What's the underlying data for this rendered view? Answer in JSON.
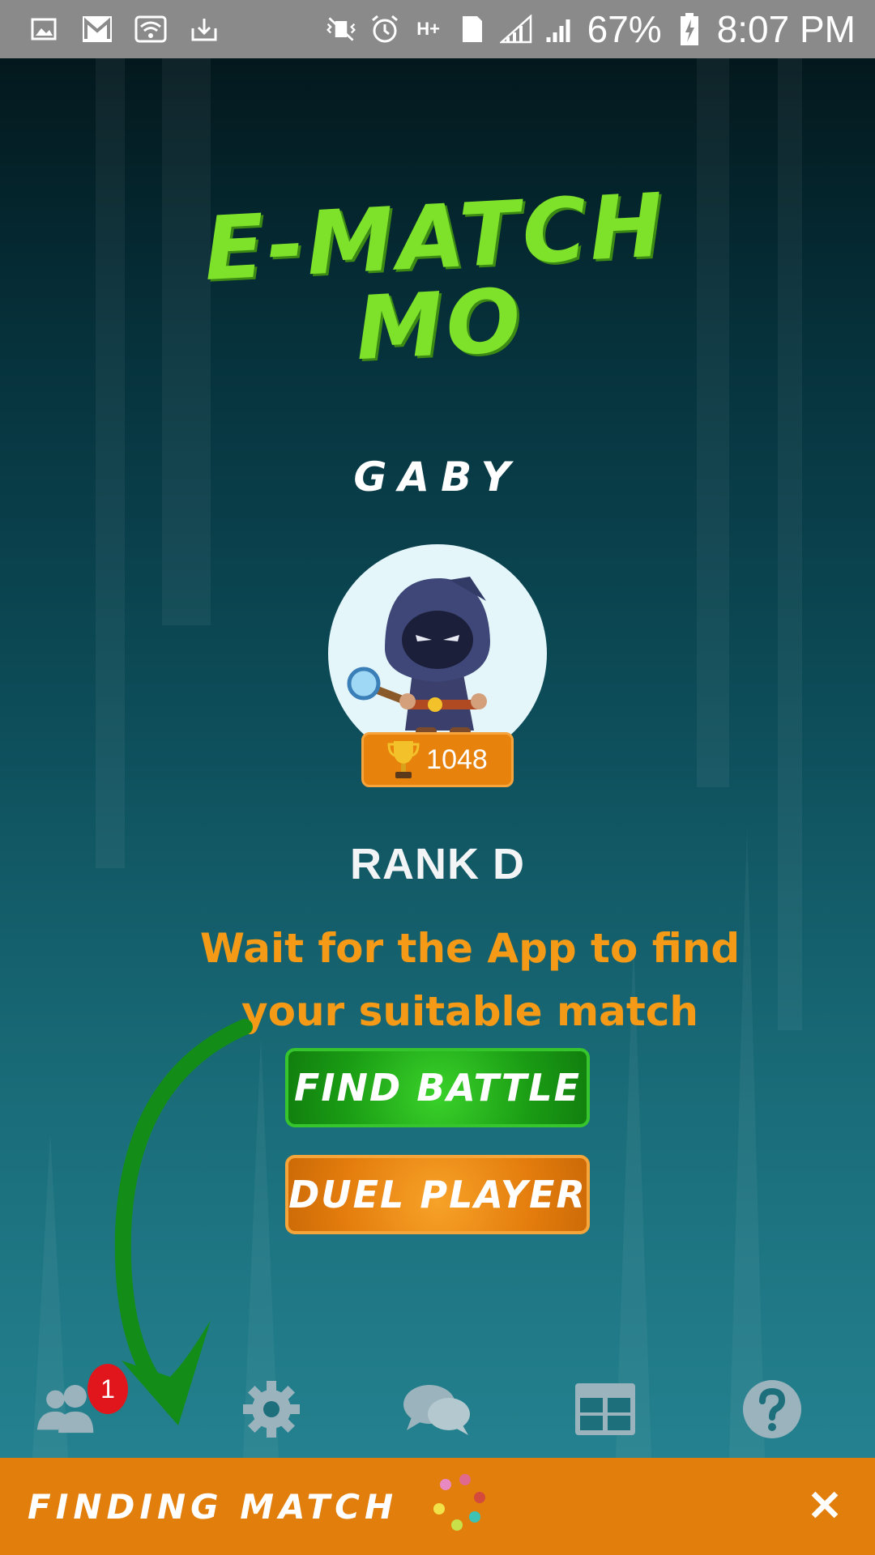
{
  "status_bar": {
    "battery": "67%",
    "time": "8:07 PM",
    "network": "H+",
    "sim": "1"
  },
  "app": {
    "logo_line1": "E-MATCH",
    "logo_line2": "MO",
    "username": "GABY",
    "trophies": "1048",
    "rank": "RANK D",
    "hint_line1": "Wait for the App to find",
    "hint_line2": "your suitable match"
  },
  "buttons": {
    "find_battle": "FIND BATTLE",
    "duel_player": "DUEL PLAYER"
  },
  "nav": {
    "friends_badge": "1",
    "items": [
      "friends-icon",
      "settings-icon",
      "chat-icon",
      "leaderboard-icon",
      "help-icon"
    ]
  },
  "match_bar": {
    "label": "FINDING MATCH",
    "close": "✕"
  },
  "colors": {
    "logo_green": "#7ee22b",
    "hint_orange": "#f59a16",
    "find_green": "#1a9c14",
    "duel_orange": "#e47d0d",
    "bar_orange": "#e27e0b",
    "badge_red": "#e0161c"
  }
}
